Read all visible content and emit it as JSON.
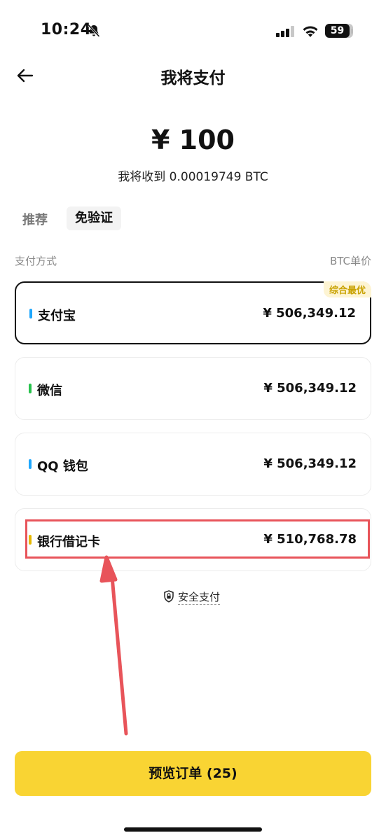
{
  "status_bar": {
    "time": "10:24",
    "battery": "59",
    "icons": [
      "bell-slash-icon",
      "signal-icon",
      "wifi-icon",
      "battery-icon"
    ]
  },
  "nav": {
    "back_icon": "arrow-left-icon",
    "title": "我将支付"
  },
  "payment": {
    "amount": "¥ 100",
    "receive": "我将收到 0.00019749 BTC"
  },
  "filters": {
    "recommended": "推荐",
    "no_verification": "免验证"
  },
  "list_header": {
    "method": "支付方式",
    "unit_price": "BTC单价"
  },
  "methods": [
    {
      "name": "支付宝",
      "price": "¥ 506,349.12",
      "badge": "综合最优",
      "color": "#1ea7fd",
      "selected": true
    },
    {
      "name": "微信",
      "price": "¥ 506,349.12",
      "color": "#27c24c"
    },
    {
      "name": "QQ 钱包",
      "price": "¥ 506,349.12",
      "color": "#1ea7fd"
    },
    {
      "name": "银行借记卡",
      "price": "¥ 510,768.78",
      "color": "#e6b800"
    }
  ],
  "secure": {
    "label": "安全支付",
    "icon": "lock-shield-icon"
  },
  "cta": {
    "label": "预览订单 (25)"
  },
  "colors": {
    "accent": "#f9d433",
    "annotation": "#e8545a"
  }
}
